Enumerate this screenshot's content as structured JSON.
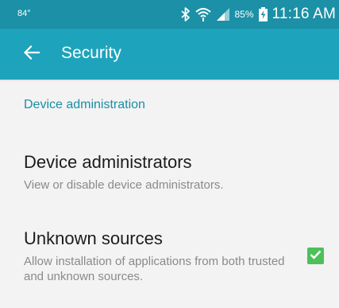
{
  "status_bar": {
    "temperature": "84°",
    "battery": "85%",
    "time": "11:16 AM",
    "icons": [
      "bluetooth-icon",
      "wifi-icon",
      "signal-icon",
      "battery-charging-icon"
    ]
  },
  "app_bar": {
    "title": "Security",
    "back_icon": "arrow-left-icon"
  },
  "section": {
    "header": "Device administration"
  },
  "preferences": [
    {
      "title": "Device administrators",
      "summary": "View or disable device administrators."
    },
    {
      "title": "Unknown sources",
      "summary": "Allow installation of applications from both trusted and unknown sources.",
      "checked": true
    }
  ],
  "colors": {
    "status_bar": "#1b90a6",
    "app_bar": "#1ea3bc",
    "accent_text": "#1a8ea4",
    "checkbox": "#4dc05a",
    "background": "#f3f3f3"
  }
}
